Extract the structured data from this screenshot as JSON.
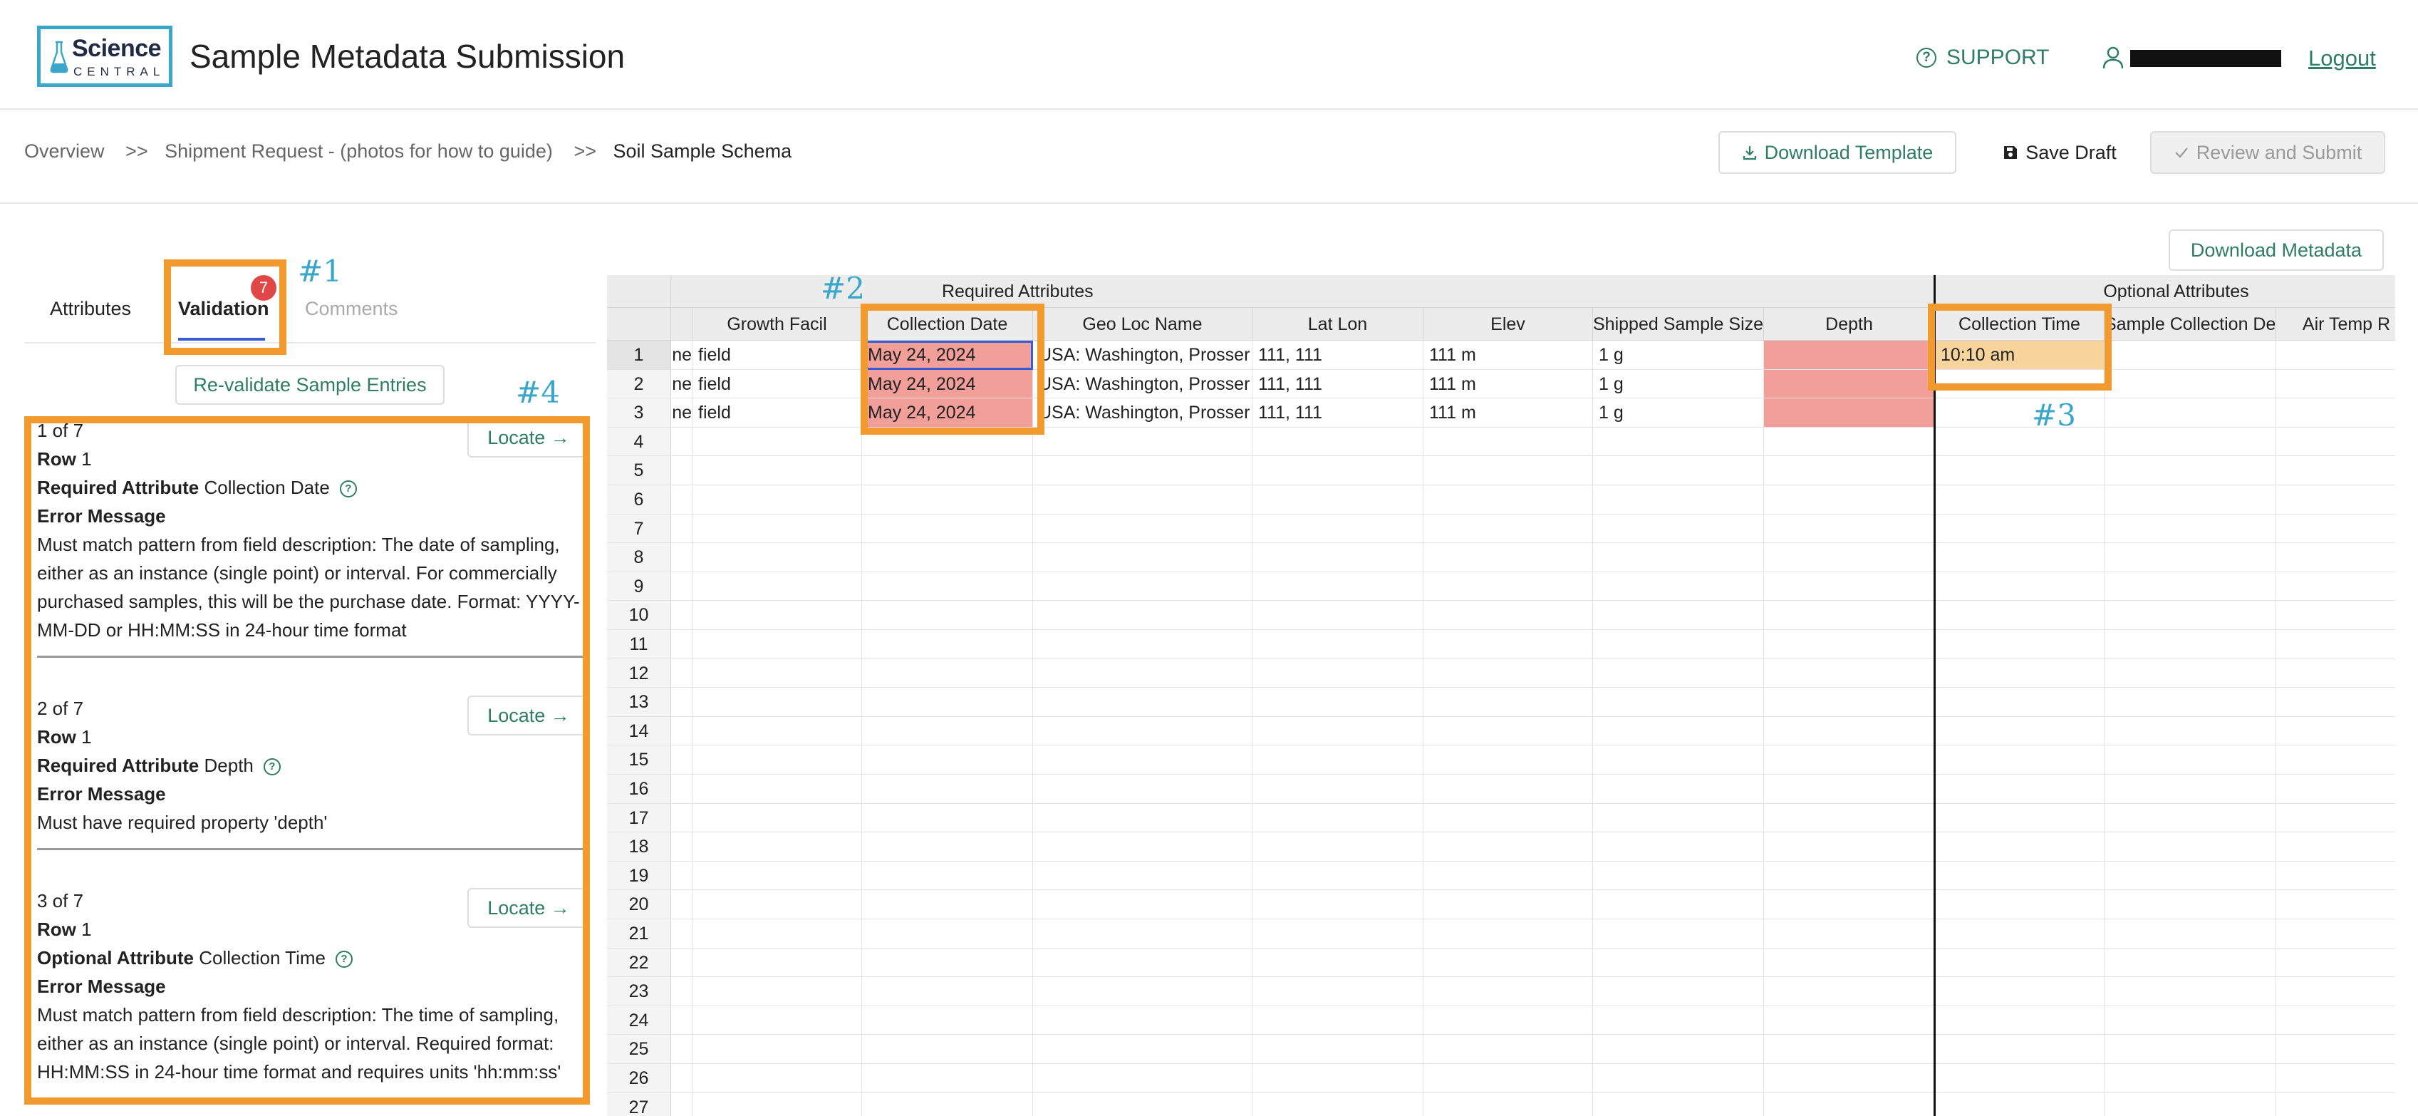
{
  "header": {
    "logo_line1": "Science",
    "logo_line2": "CENTRAL",
    "title": "Sample Metadata Submission",
    "support_label": "SUPPORT",
    "logout_label": "Logout"
  },
  "breadcrumb": [
    "Overview",
    "Shipment Request - (photos for how to guide)",
    "Soil Sample Schema"
  ],
  "breadcrumb_separator": ">>",
  "toolbar": {
    "download_template": "Download Template",
    "save_draft": "Save Draft",
    "review_submit": "Review and Submit"
  },
  "tabs": [
    {
      "label": "Attributes"
    },
    {
      "label": "Validation",
      "active": true,
      "badge": "7"
    },
    {
      "label": "Comments"
    }
  ],
  "revalidate_label": "Re-validate Sample Entries",
  "locate_label": "Locate →",
  "error_labels": {
    "row": "Row",
    "error_message": "Error Message"
  },
  "errors": [
    {
      "counter": "1 of 7",
      "row": "1",
      "attribute_type": "Required Attribute",
      "attribute": "Collection Date",
      "message": "Must match pattern from field description: The date of sampling, either as an instance (single point) or interval. For commercially purchased samples, this will be the purchase date. Format: YYYY-MM-DD or HH:MM:SS in 24-hour time format"
    },
    {
      "counter": "2 of 7",
      "row": "1",
      "attribute_type": "Required Attribute",
      "attribute": "Depth",
      "message": "Must have required property 'depth'"
    },
    {
      "counter": "3 of 7",
      "row": "1",
      "attribute_type": "Optional Attribute",
      "attribute": "Collection Time",
      "message": "Must match pattern from field description: The time of sampling, either as an instance (single point) or interval. Required format: HH:MM:SS in 24-hour time format and requires units 'hh:mm:ss'"
    }
  ],
  "annotations": [
    "#1",
    "#2",
    "#3",
    "#4"
  ],
  "download_metadata_label": "Download Metadata",
  "grid": {
    "group_required": "Required Attributes",
    "group_optional": "Optional Attributes",
    "columns": [
      "",
      "Growth Facil",
      "Collection Date",
      "Geo Loc Name",
      "Lat Lon",
      "Elev",
      "Shipped Sample Size",
      "Depth",
      "Collection Time",
      "Sample Collection Dev",
      "Air Temp R"
    ],
    "rows": [
      [
        "ne",
        "field",
        "May 24, 2024",
        "USA: Washington, Prosser",
        "111, 111",
        "111 m",
        "1 g",
        "",
        "10:10 am",
        "",
        ""
      ],
      [
        "ne",
        "field",
        "May 24, 2024",
        "USA: Washington, Prosser",
        "111, 111",
        "111 m",
        "1 g",
        "",
        "",
        "",
        ""
      ],
      [
        "ne",
        "field",
        "May 24, 2024",
        "USA: Washington, Prosser",
        "111, 111",
        "111 m",
        "1 g",
        "",
        "",
        "",
        ""
      ]
    ],
    "row_numbers": [
      "1",
      "2",
      "3",
      "4",
      "5",
      "6",
      "7",
      "8",
      "9",
      "10",
      "11",
      "12",
      "13",
      "14",
      "15",
      "16",
      "17",
      "18",
      "19",
      "20",
      "21",
      "22",
      "23",
      "24",
      "25",
      "26",
      "27"
    ],
    "colors": {
      "error": "#f29e99",
      "warning": "#f7d49c",
      "annotation": "#f39a2e",
      "accent": "#2e7d64"
    }
  }
}
